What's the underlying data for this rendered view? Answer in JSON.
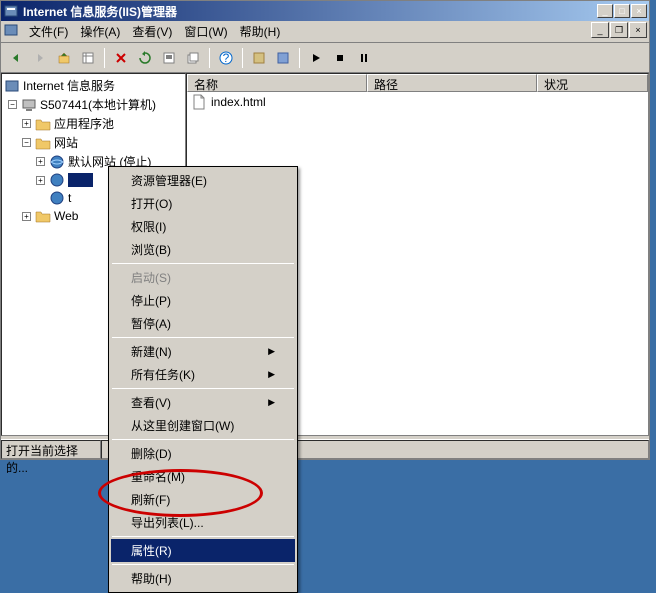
{
  "window": {
    "title": "Internet 信息服务(IIS)管理器"
  },
  "menu": {
    "file": "文件(F)",
    "action": "操作(A)",
    "view": "查看(V)",
    "window": "窗口(W)",
    "help": "帮助(H)"
  },
  "tree": {
    "root": "Internet 信息服务",
    "computer": "S507441(本地计算机)",
    "app_pools": "应用程序池",
    "websites": "网站",
    "default_site": "默认网站 (停止)",
    "site_t": "t",
    "web_folder": "Web "
  },
  "list": {
    "columns": {
      "name": "名称",
      "path": "路径",
      "status": "状况"
    },
    "rows": [
      {
        "name": "index.html"
      }
    ]
  },
  "status": {
    "text": "打开当前选择的..."
  },
  "context": {
    "explorer": "资源管理器(E)",
    "open": "打开(O)",
    "permissions": "权限(I)",
    "browse": "浏览(B)",
    "start": "启动(S)",
    "stop": "停止(P)",
    "pause": "暂停(A)",
    "new": "新建(N)",
    "all_tasks": "所有任务(K)",
    "view": "查看(V)",
    "window_here": "从这里创建窗口(W)",
    "delete": "删除(D)",
    "rename": "重命名(M)",
    "refresh": "刷新(F)",
    "export_list": "导出列表(L)...",
    "properties": "属性(R)",
    "help": "帮助(H)"
  }
}
